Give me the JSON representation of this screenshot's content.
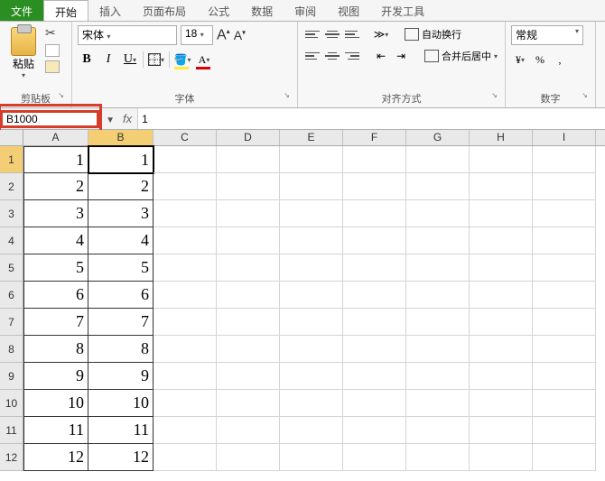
{
  "tabs": {
    "file": "文件",
    "home": "开始",
    "insert": "插入",
    "layout": "页面布局",
    "formula": "公式",
    "data": "数据",
    "review": "审阅",
    "view": "视图",
    "dev": "开发工具"
  },
  "ribbon": {
    "clipboard": {
      "paste": "粘贴",
      "label": "剪贴板"
    },
    "font": {
      "name": "宋体",
      "size": "18",
      "label": "字体"
    },
    "align": {
      "wrap": "自动换行",
      "merge": "合并后居中",
      "label": "对齐方式"
    },
    "number": {
      "format": "常规",
      "label": "数字"
    }
  },
  "fbar": {
    "name_box": "B1000",
    "formula": "1"
  },
  "cols": [
    "A",
    "B",
    "C",
    "D",
    "E",
    "F",
    "G",
    "H",
    "I"
  ],
  "rows": [
    {
      "n": "1",
      "a": "1",
      "b": "1"
    },
    {
      "n": "2",
      "a": "2",
      "b": "2"
    },
    {
      "n": "3",
      "a": "3",
      "b": "3"
    },
    {
      "n": "4",
      "a": "4",
      "b": "4"
    },
    {
      "n": "5",
      "a": "5",
      "b": "5"
    },
    {
      "n": "6",
      "a": "6",
      "b": "6"
    },
    {
      "n": "7",
      "a": "7",
      "b": "7"
    },
    {
      "n": "8",
      "a": "8",
      "b": "8"
    },
    {
      "n": "9",
      "a": "9",
      "b": "9"
    },
    {
      "n": "10",
      "a": "10",
      "b": "10"
    },
    {
      "n": "11",
      "a": "11",
      "b": "11"
    },
    {
      "n": "12",
      "a": "12",
      "b": "12"
    }
  ],
  "active_cell": "B1"
}
